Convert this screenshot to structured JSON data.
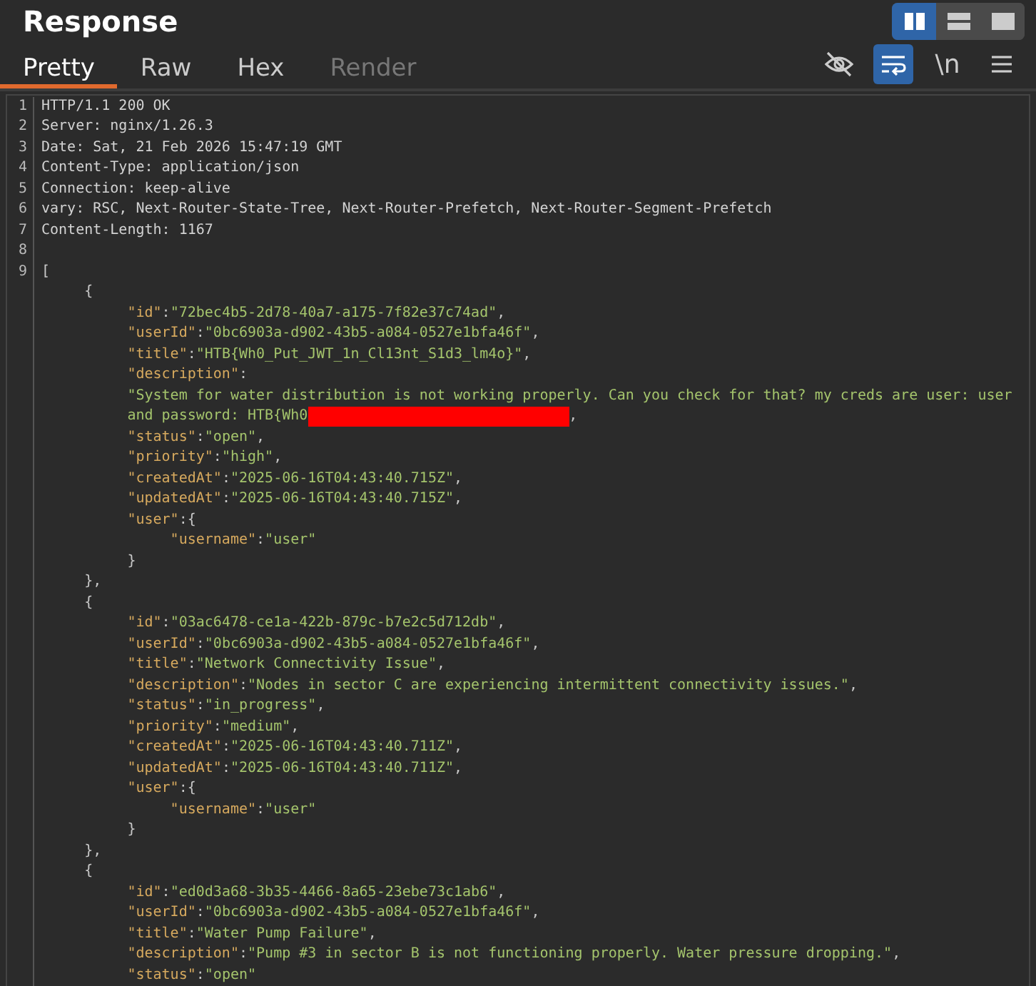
{
  "panel": {
    "title": "Response"
  },
  "layout_buttons": [
    {
      "kind": "split",
      "selected": true
    },
    {
      "kind": "stacked",
      "selected": false
    },
    {
      "kind": "single",
      "selected": false
    }
  ],
  "tabs": [
    {
      "label": "Pretty",
      "selected": true,
      "disabled": false
    },
    {
      "label": "Raw",
      "selected": false,
      "disabled": false
    },
    {
      "label": "Hex",
      "selected": false,
      "disabled": false
    },
    {
      "label": "Render",
      "selected": false,
      "disabled": true
    }
  ],
  "tools": [
    {
      "kind": "hide",
      "on": false
    },
    {
      "kind": "wrap",
      "on": true
    },
    {
      "kind": "newline",
      "label": "\\n",
      "on": false
    },
    {
      "kind": "menu",
      "on": false
    }
  ],
  "lines": [
    {
      "number": "1",
      "tokens": [
        {
          "kind": "plain",
          "text": "HTTP/1.1 200 OK"
        }
      ]
    },
    {
      "number": "2",
      "tokens": [
        {
          "kind": "plain",
          "text": "Server: nginx/1.26.3"
        }
      ]
    },
    {
      "number": "3",
      "tokens": [
        {
          "kind": "plain",
          "text": "Date: Sat, 21 Feb 2026 15:47:19 GMT"
        }
      ]
    },
    {
      "number": "4",
      "tokens": [
        {
          "kind": "plain",
          "text": "Content-Type: application/json"
        }
      ]
    },
    {
      "number": "5",
      "tokens": [
        {
          "kind": "plain",
          "text": "Connection: keep-alive"
        }
      ]
    },
    {
      "number": "6",
      "tokens": [
        {
          "kind": "plain",
          "text": "vary: RSC, Next-Router-State-Tree, Next-Router-Prefetch, Next-Router-Segment-Prefetch"
        }
      ]
    },
    {
      "number": "7",
      "tokens": [
        {
          "kind": "plain",
          "text": "Content-Length: 1167"
        }
      ]
    },
    {
      "number": "8"
    },
    {
      "number": "9",
      "tokens": [
        {
          "kind": "punct",
          "text": "["
        }
      ]
    },
    {
      "tokens": [
        {
          "kind": "punct",
          "text": "     {"
        }
      ]
    },
    {
      "tokens": [
        {
          "kind": "key",
          "text": "          \"id\""
        },
        {
          "kind": "punct",
          "text": ":"
        },
        {
          "kind": "str",
          "text": "\"72bec4b5-2d78-40a7-a175-7f82e37c74ad\""
        },
        {
          "kind": "punct",
          "text": ","
        }
      ]
    },
    {
      "tokens": [
        {
          "kind": "key",
          "text": "          \"userId\""
        },
        {
          "kind": "punct",
          "text": ":"
        },
        {
          "kind": "str",
          "text": "\"0bc6903a-d902-43b5-a084-0527e1bfa46f\""
        },
        {
          "kind": "punct",
          "text": ","
        }
      ]
    },
    {
      "tokens": [
        {
          "kind": "key",
          "text": "          \"title\""
        },
        {
          "kind": "punct",
          "text": ":"
        },
        {
          "kind": "str",
          "text": "\"HTB{Wh0_Put_JWT_1n_Cl13nt_S1d3_lm4o}\""
        },
        {
          "kind": "punct",
          "text": ","
        }
      ]
    },
    {
      "tokens": [
        {
          "kind": "key",
          "text": "          \"description\""
        },
        {
          "kind": "punct",
          "text": ":"
        }
      ]
    },
    {
      "tokens": [
        {
          "kind": "str",
          "text": "          \"System for water distribution is not working properly. Can you check for that? my creds are user: user"
        }
      ]
    },
    {
      "tokens": [
        {
          "kind": "str",
          "text": "          and password: HTB{Wh0"
        },
        {
          "kind": "redacted"
        },
        {
          "kind": "punct",
          "text": ","
        }
      ]
    },
    {
      "tokens": [
        {
          "kind": "key",
          "text": "          \"status\""
        },
        {
          "kind": "punct",
          "text": ":"
        },
        {
          "kind": "str",
          "text": "\"open\""
        },
        {
          "kind": "punct",
          "text": ","
        }
      ]
    },
    {
      "tokens": [
        {
          "kind": "key",
          "text": "          \"priority\""
        },
        {
          "kind": "punct",
          "text": ":"
        },
        {
          "kind": "str",
          "text": "\"high\""
        },
        {
          "kind": "punct",
          "text": ","
        }
      ]
    },
    {
      "tokens": [
        {
          "kind": "key",
          "text": "          \"createdAt\""
        },
        {
          "kind": "punct",
          "text": ":"
        },
        {
          "kind": "str",
          "text": "\"2025-06-16T04:43:40.715Z\""
        },
        {
          "kind": "punct",
          "text": ","
        }
      ]
    },
    {
      "tokens": [
        {
          "kind": "key",
          "text": "          \"updatedAt\""
        },
        {
          "kind": "punct",
          "text": ":"
        },
        {
          "kind": "str",
          "text": "\"2025-06-16T04:43:40.715Z\""
        },
        {
          "kind": "punct",
          "text": ","
        }
      ]
    },
    {
      "tokens": [
        {
          "kind": "key",
          "text": "          \"user\""
        },
        {
          "kind": "punct",
          "text": ":{"
        }
      ]
    },
    {
      "tokens": [
        {
          "kind": "key",
          "text": "               \"username\""
        },
        {
          "kind": "punct",
          "text": ":"
        },
        {
          "kind": "str",
          "text": "\"user\""
        }
      ]
    },
    {
      "tokens": [
        {
          "kind": "punct",
          "text": "          }"
        }
      ]
    },
    {
      "tokens": [
        {
          "kind": "punct",
          "text": "     },"
        }
      ]
    },
    {
      "tokens": [
        {
          "kind": "punct",
          "text": "     {"
        }
      ]
    },
    {
      "tokens": [
        {
          "kind": "key",
          "text": "          \"id\""
        },
        {
          "kind": "punct",
          "text": ":"
        },
        {
          "kind": "str",
          "text": "\"03ac6478-ce1a-422b-879c-b7e2c5d712db\""
        },
        {
          "kind": "punct",
          "text": ","
        }
      ]
    },
    {
      "tokens": [
        {
          "kind": "key",
          "text": "          \"userId\""
        },
        {
          "kind": "punct",
          "text": ":"
        },
        {
          "kind": "str",
          "text": "\"0bc6903a-d902-43b5-a084-0527e1bfa46f\""
        },
        {
          "kind": "punct",
          "text": ","
        }
      ]
    },
    {
      "tokens": [
        {
          "kind": "key",
          "text": "          \"title\""
        },
        {
          "kind": "punct",
          "text": ":"
        },
        {
          "kind": "str",
          "text": "\"Network Connectivity Issue\""
        },
        {
          "kind": "punct",
          "text": ","
        }
      ]
    },
    {
      "tokens": [
        {
          "kind": "key",
          "text": "          \"description\""
        },
        {
          "kind": "punct",
          "text": ":"
        },
        {
          "kind": "str",
          "text": "\"Nodes in sector C are experiencing intermittent connectivity issues.\""
        },
        {
          "kind": "punct",
          "text": ","
        }
      ]
    },
    {
      "tokens": [
        {
          "kind": "key",
          "text": "          \"status\""
        },
        {
          "kind": "punct",
          "text": ":"
        },
        {
          "kind": "str",
          "text": "\"in_progress\""
        },
        {
          "kind": "punct",
          "text": ","
        }
      ]
    },
    {
      "tokens": [
        {
          "kind": "key",
          "text": "          \"priority\""
        },
        {
          "kind": "punct",
          "text": ":"
        },
        {
          "kind": "str",
          "text": "\"medium\""
        },
        {
          "kind": "punct",
          "text": ","
        }
      ]
    },
    {
      "tokens": [
        {
          "kind": "key",
          "text": "          \"createdAt\""
        },
        {
          "kind": "punct",
          "text": ":"
        },
        {
          "kind": "str",
          "text": "\"2025-06-16T04:43:40.711Z\""
        },
        {
          "kind": "punct",
          "text": ","
        }
      ]
    },
    {
      "tokens": [
        {
          "kind": "key",
          "text": "          \"updatedAt\""
        },
        {
          "kind": "punct",
          "text": ":"
        },
        {
          "kind": "str",
          "text": "\"2025-06-16T04:43:40.711Z\""
        },
        {
          "kind": "punct",
          "text": ","
        }
      ]
    },
    {
      "tokens": [
        {
          "kind": "key",
          "text": "          \"user\""
        },
        {
          "kind": "punct",
          "text": ":{"
        }
      ]
    },
    {
      "tokens": [
        {
          "kind": "key",
          "text": "               \"username\""
        },
        {
          "kind": "punct",
          "text": ":"
        },
        {
          "kind": "str",
          "text": "\"user\""
        }
      ]
    },
    {
      "tokens": [
        {
          "kind": "punct",
          "text": "          }"
        }
      ]
    },
    {
      "tokens": [
        {
          "kind": "punct",
          "text": "     },"
        }
      ]
    },
    {
      "tokens": [
        {
          "kind": "punct",
          "text": "     {"
        }
      ]
    },
    {
      "tokens": [
        {
          "kind": "key",
          "text": "          \"id\""
        },
        {
          "kind": "punct",
          "text": ":"
        },
        {
          "kind": "str",
          "text": "\"ed0d3a68-3b35-4466-8a65-23ebe73c1ab6\""
        },
        {
          "kind": "punct",
          "text": ","
        }
      ]
    },
    {
      "tokens": [
        {
          "kind": "key",
          "text": "          \"userId\""
        },
        {
          "kind": "punct",
          "text": ":"
        },
        {
          "kind": "str",
          "text": "\"0bc6903a-d902-43b5-a084-0527e1bfa46f\""
        },
        {
          "kind": "punct",
          "text": ","
        }
      ]
    },
    {
      "tokens": [
        {
          "kind": "key",
          "text": "          \"title\""
        },
        {
          "kind": "punct",
          "text": ":"
        },
        {
          "kind": "str",
          "text": "\"Water Pump Failure\""
        },
        {
          "kind": "punct",
          "text": ","
        }
      ]
    },
    {
      "tokens": [
        {
          "kind": "key",
          "text": "          \"description\""
        },
        {
          "kind": "punct",
          "text": ":"
        },
        {
          "kind": "str",
          "text": "\"Pump #3 in sector B is not functioning properly. Water pressure dropping.\""
        },
        {
          "kind": "punct",
          "text": ","
        }
      ]
    },
    {
      "tokens": [
        {
          "kind": "key",
          "text": "          \"status\""
        },
        {
          "kind": "punct",
          "text": ":"
        },
        {
          "kind": "str",
          "text": "\"open\""
        }
      ]
    }
  ]
}
